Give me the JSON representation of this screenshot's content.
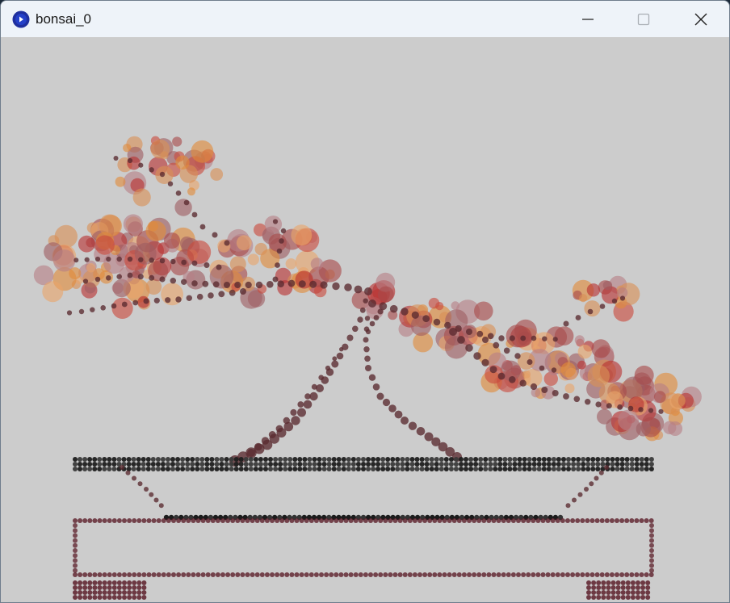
{
  "window": {
    "title": "bonsai_0",
    "app_icon": "processing-app-icon",
    "controls": [
      "minimize-icon",
      "maximize-icon",
      "close-icon"
    ]
  },
  "sketch": {
    "background": "#cccccc",
    "foliage_colors": [
      "#e8a56a",
      "#d98f55",
      "#c94b3e",
      "#b83232",
      "#b67f86",
      "#9e5d63",
      "#a84a4a",
      "#e08a3a"
    ],
    "branch_color": "#5a2a30",
    "pot_top_color": "#1e1e1e",
    "pot_base_color": "#5c1f2a"
  }
}
